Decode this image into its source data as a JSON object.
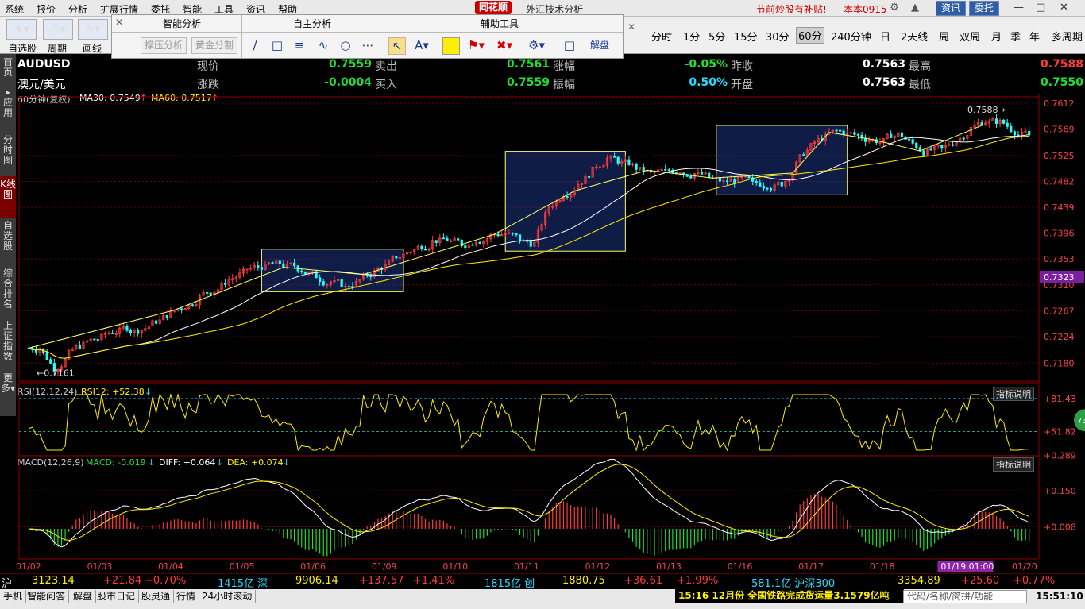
{
  "menu": [
    "系统",
    "报价",
    "分析",
    "扩展行情",
    "委托",
    "智能",
    "工具",
    "资讯",
    "帮助"
  ],
  "brand": "同花顺",
  "app_title": "- 外汇技术分析",
  "promo": "节前炒股有补贴!",
  "account": "本本0915",
  "top_buttons": {
    "news": "资讯",
    "trade": "委托"
  },
  "toolbar": {
    "self_select": "自选股",
    "cycle": "周期",
    "draw": "画线",
    "panel_smart": "智能分析",
    "panel_self": "自主分析",
    "panel_aux": "辅助工具",
    "btn_pressure": "撑压分析",
    "btn_gold": "黄金分割",
    "btn_explain": "解盘"
  },
  "periods": [
    "分时",
    "1分",
    "5分",
    "15分",
    "30分",
    "60分",
    "240分钟",
    "日",
    "2天线",
    "周",
    "双周",
    "月",
    "季",
    "年",
    "多周期"
  ],
  "active_period": "60分",
  "side_tabs": [
    "首页",
    "应用",
    "分时图",
    "K线图",
    "自选股",
    "综合排名",
    "上证指数",
    "更多"
  ],
  "quote": {
    "symbol": "AUDUSD",
    "name": "澳元/美元",
    "price_label": "现价",
    "price": "0.7559",
    "change_label": "涨跌",
    "change": "-0.0004",
    "sell_label": "卖出",
    "sell": "0.7561",
    "buy_label": "买入",
    "buy": "0.7559",
    "pct_label": "涨幅",
    "pct": "-0.05%",
    "amp_label": "振幅",
    "amp": "0.50%",
    "prev_label": "昨收",
    "prev": "0.7563",
    "open_label": "开盘",
    "open": "0.7563",
    "high_label": "最高",
    "high": "0.7588",
    "low_label": "最低",
    "low": "0.7550"
  },
  "ma_legend": {
    "period": "60分钟(复权)",
    "ma30": "MA30: 0.7549",
    "ma60": "MA60: 0.7517"
  },
  "rsi_legend": {
    "title": "RSI(12,12,24)",
    "value": "RSI12: +52.38"
  },
  "macd_legend": {
    "title": "MACD(12,26,9)",
    "macd": "MACD: -0.019",
    "diff": "DIFF: +0.064",
    "dea": "DEA: +0.074"
  },
  "hint_label": "指标说明",
  "chart_data": {
    "type": "candlestick",
    "price_axis": [
      "0.7612",
      "0.7569",
      "0.7525",
      "0.7482",
      "0.7439",
      "0.7396",
      "0.7353",
      "0.7310",
      "0.7267",
      "0.7224",
      "0.7180"
    ],
    "price_ylim": [
      0.715,
      0.7612
    ],
    "current_price_tag": "0.7323",
    "high_mark": "0.7588",
    "low_mark": "0.7161",
    "rsi_axis": [
      "+81.43",
      "+51.82"
    ],
    "rsi_badge": "73",
    "macd_axis": [
      "+0.289",
      "+0.150",
      "+0.008"
    ],
    "dates": [
      "01/02",
      "01/03",
      "01/04",
      "01/05",
      "01/06",
      "01/09",
      "01/10",
      "01/11",
      "01/12",
      "01/13",
      "01/16",
      "01/17",
      "01/18",
      "01/19 01:00",
      "01/20"
    ],
    "highlight_date": "01/19 01:00",
    "close_series": [
      0.7205,
      0.7172,
      0.7195,
      0.721,
      0.722,
      0.7232,
      0.724,
      0.7235,
      0.725,
      0.7262,
      0.7275,
      0.729,
      0.73,
      0.7318,
      0.733,
      0.734,
      0.7345,
      0.734,
      0.7335,
      0.7325,
      0.7315,
      0.7305,
      0.7318,
      0.733,
      0.7345,
      0.736,
      0.7372,
      0.7382,
      0.7385,
      0.7378,
      0.7385,
      0.7392,
      0.7396,
      0.7385,
      0.7378,
      0.744,
      0.7462,
      0.7478,
      0.75,
      0.752,
      0.7512,
      0.7505,
      0.7495,
      0.7498,
      0.75,
      0.7495,
      0.7488,
      0.748,
      0.7483,
      0.7478,
      0.7476,
      0.7479,
      0.751,
      0.754,
      0.7555,
      0.7565,
      0.756,
      0.7552,
      0.7548,
      0.756,
      0.7545,
      0.753,
      0.7535,
      0.755,
      0.757,
      0.7582,
      0.758,
      0.7565,
      0.7559
    ]
  },
  "index_bar": [
    {
      "name": "沪",
      "v": "3123.14",
      "c": "+21.84",
      "p": "+0.70%"
    },
    {
      "name": "1415亿 深",
      "v": "9906.14",
      "c": "+137.57",
      "p": "+1.41%"
    },
    {
      "name": "1815亿 创",
      "v": "1880.75",
      "c": "+36.61",
      "p": "+1.99%"
    },
    {
      "name": "581.1亿 沪深300",
      "v": "3354.89",
      "c": "+25.60",
      "p": "+0.77%"
    }
  ],
  "status_items": [
    "手机",
    "智能问答",
    "解盘",
    "股市日记",
    "股灵通",
    "行情",
    "24小时滚动"
  ],
  "news": "15:16 12月份 全国铁路完成货运量3.1579亿吨",
  "search_placeholder": "代码/名称/简拼/功能",
  "clock": "15:51:10"
}
